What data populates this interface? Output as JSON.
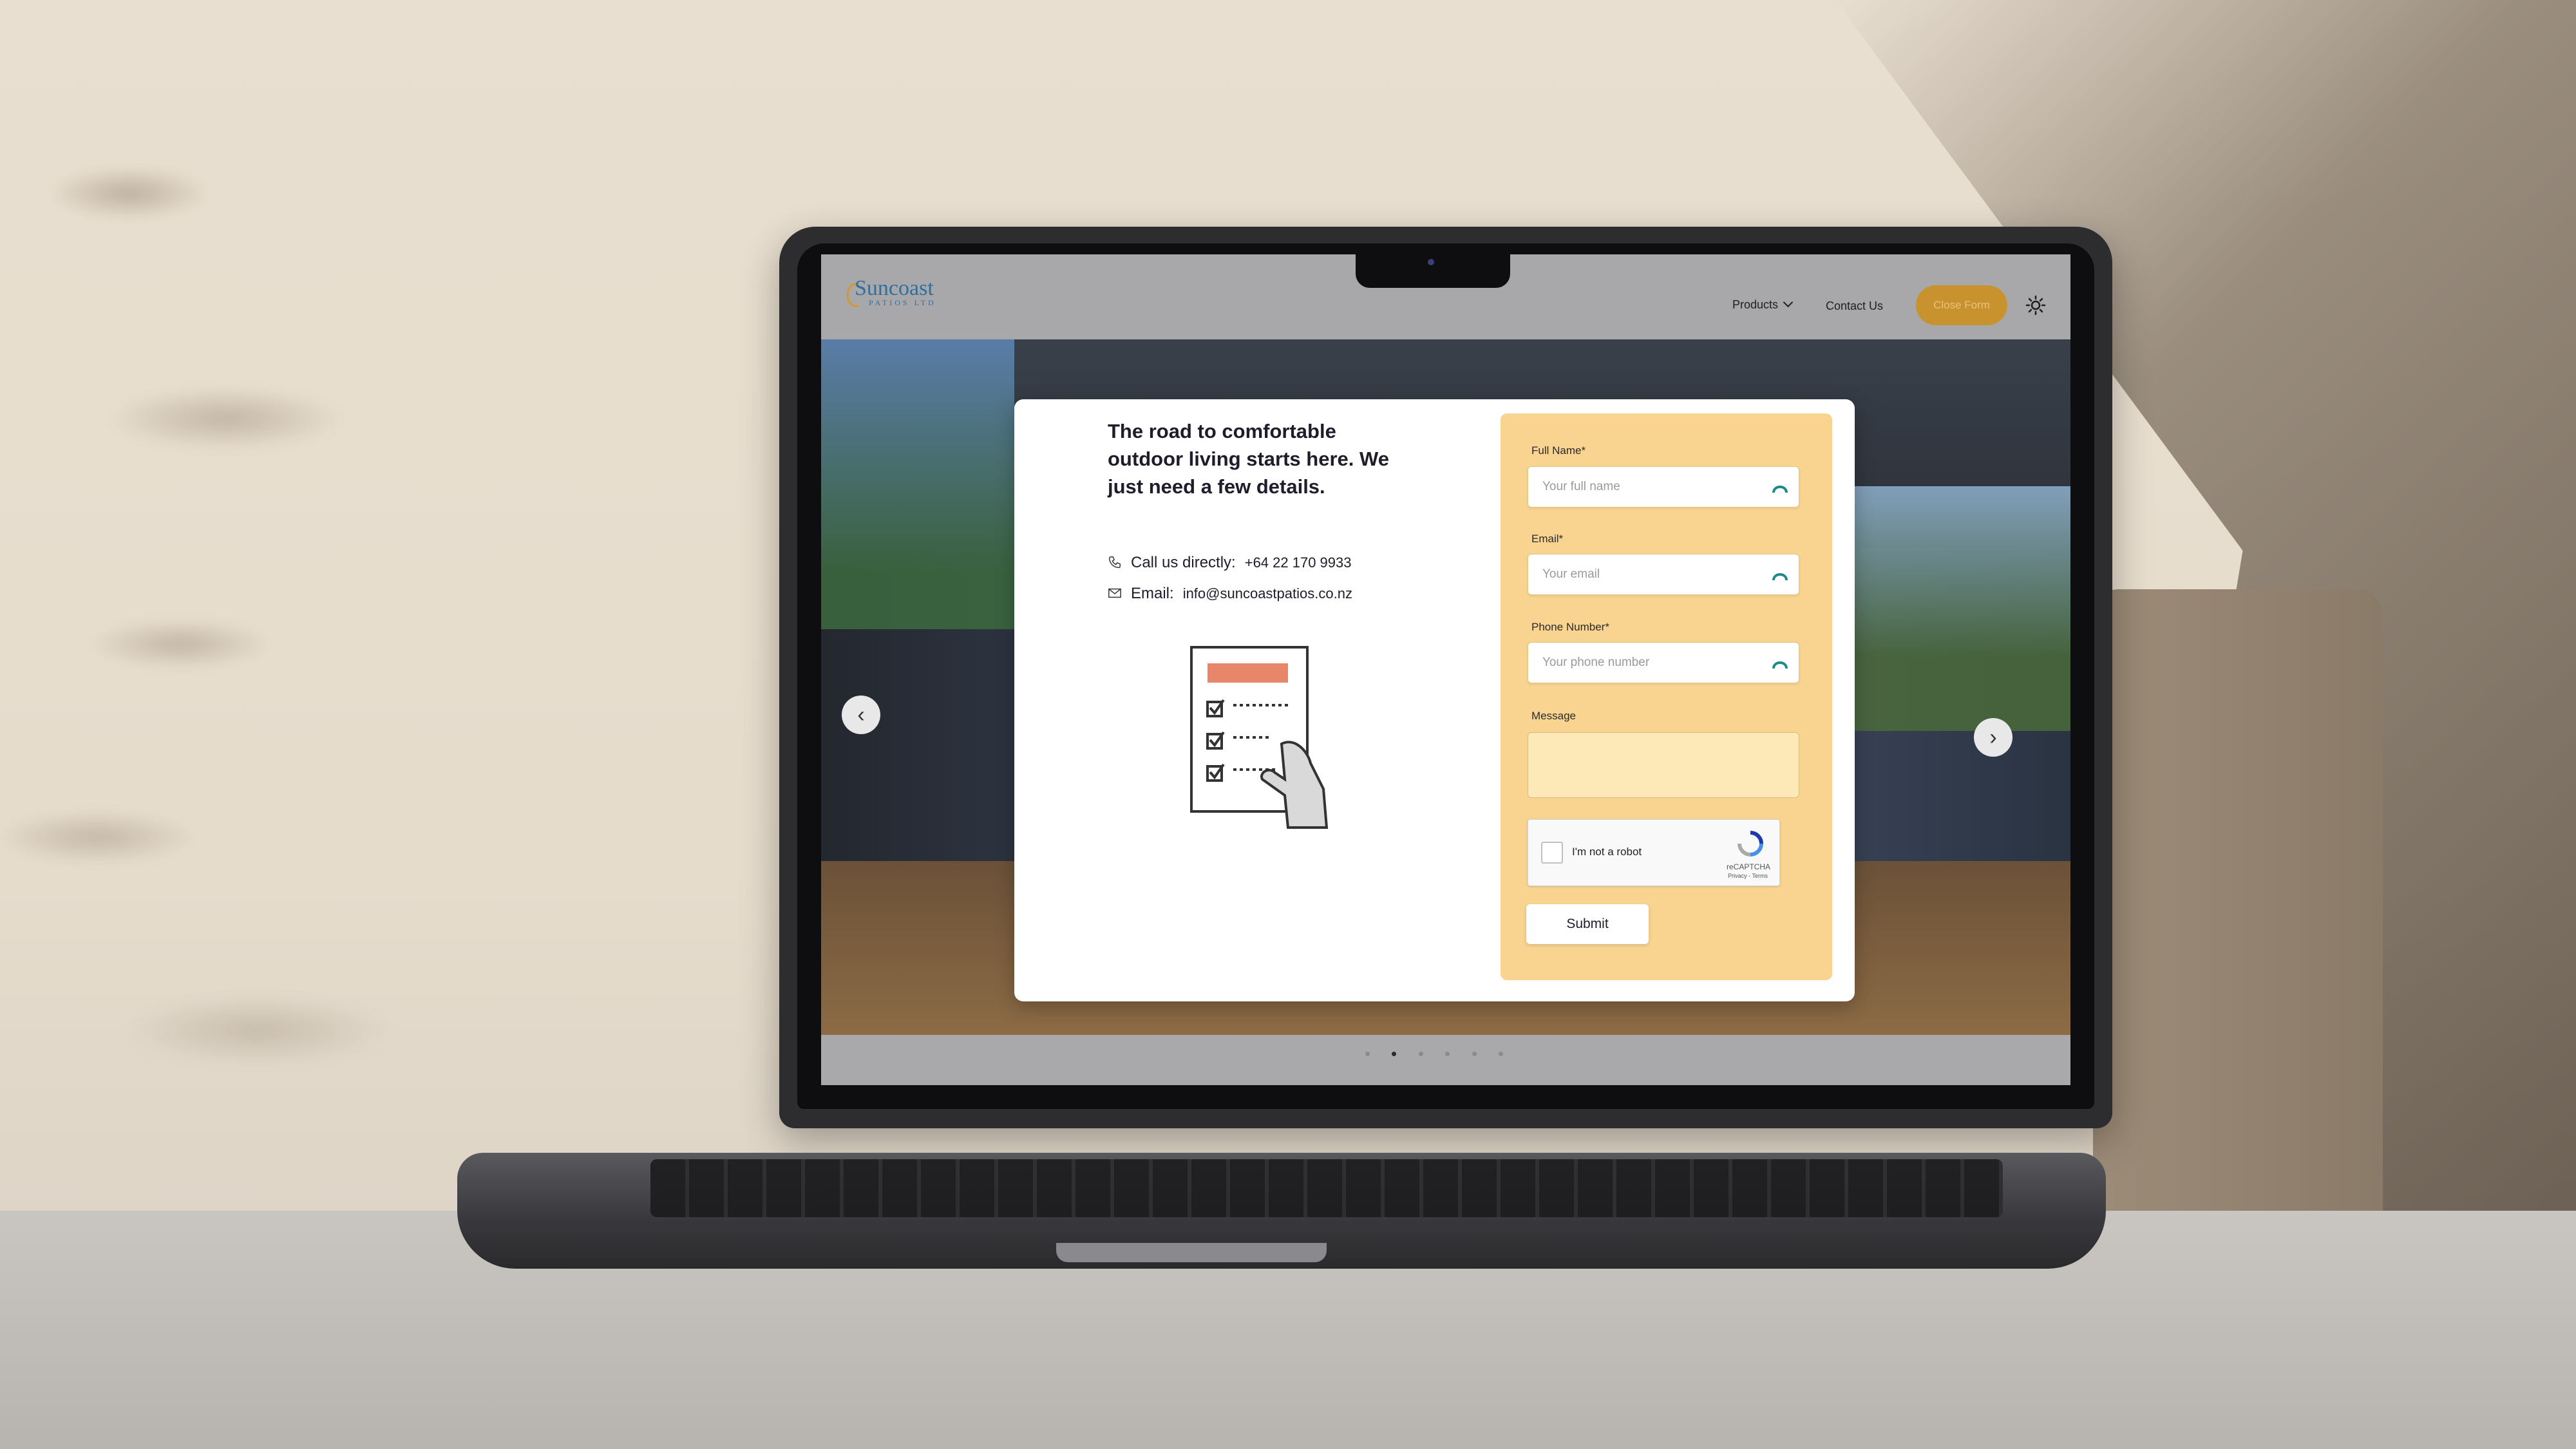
{
  "nav": {
    "logo_main": "Suncoast",
    "logo_sub": "PATIOS LTD",
    "products_label": "Products",
    "contact_label": "Contact Us",
    "close_form_label": "Close Form"
  },
  "modal": {
    "heading": "The road to comfortable outdoor living starts here. We just need a few details.",
    "call_label": "Call us directly:",
    "call_value": "+64 22 170 9933",
    "email_label": "Email:",
    "email_value": "info@suncoastpatios.co.nz"
  },
  "form": {
    "full_name_label": "Full Name*",
    "full_name_placeholder": "Your full name",
    "email_label": "Email*",
    "email_placeholder": "Your email",
    "phone_label": "Phone Number*",
    "phone_placeholder": "Your phone number",
    "message_label": "Message",
    "captcha_text": "I'm not a robot",
    "captcha_brand": "reCAPTCHA",
    "captcha_terms": "Privacy - Terms",
    "submit_label": "Submit"
  },
  "slider": {
    "prev": "‹",
    "next": "›",
    "slide_count": 6,
    "active_index": 1
  },
  "colors": {
    "accent": "#c8922f",
    "form_panel": "#f8d490",
    "logo_blue": "#2f6f9e"
  },
  "icons": {
    "phone": "phone-icon",
    "email": "envelope-icon",
    "theme": "sun-icon",
    "password_manager": "password-manager-icon"
  }
}
